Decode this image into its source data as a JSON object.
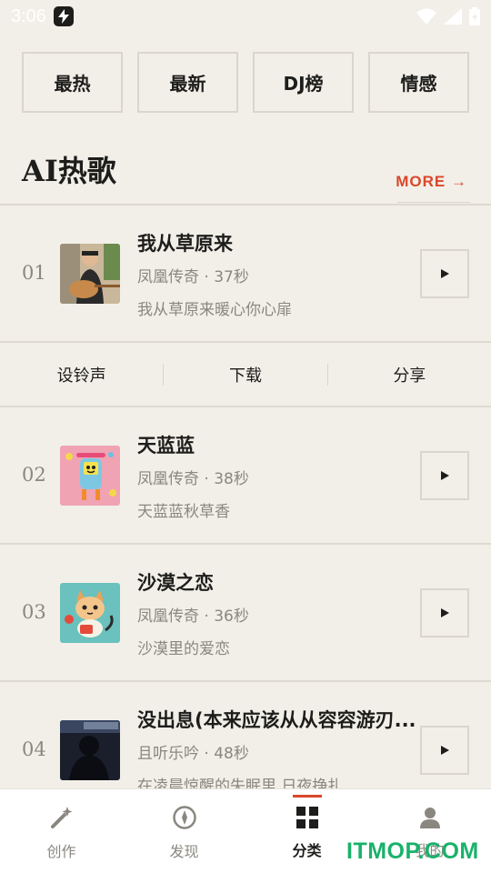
{
  "status_bar": {
    "time": "3:06"
  },
  "categories": [
    {
      "label": "最热"
    },
    {
      "label": "最新"
    },
    {
      "label": "DJ榜"
    },
    {
      "label": "情感"
    }
  ],
  "section": {
    "title": "AI热歌",
    "more_label": "MORE →"
  },
  "songs": [
    {
      "num": "01",
      "title": "我从草原来",
      "meta": "凤凰传奇 · 37秒",
      "lyric": "我从草原来暖心你心扉",
      "cover": "guitarist-photo"
    },
    {
      "num": "02",
      "title": "天蓝蓝",
      "meta": "凤凰传奇 · 38秒",
      "lyric": "天蓝蓝秋草香",
      "cover": "cartoon-character"
    },
    {
      "num": "03",
      "title": "沙漠之恋",
      "meta": "凤凰传奇 · 36秒",
      "lyric": "沙漠里的爱恋",
      "cover": "cartoon-cat"
    },
    {
      "num": "04",
      "title": "没出息(本来应该从从容容游刃...",
      "meta": "且听乐吟 · 48秒",
      "lyric": "在凌晨惊醒的失眠里 日夜挣扎",
      "cover": "dark-silhouette"
    }
  ],
  "song_actions": [
    {
      "label": "设铃声"
    },
    {
      "label": "下载"
    },
    {
      "label": "分享"
    }
  ],
  "bottom_nav": [
    {
      "label": "创作",
      "icon": "magic-wand-icon",
      "active": false
    },
    {
      "label": "发现",
      "icon": "compass-icon",
      "active": false
    },
    {
      "label": "分类",
      "icon": "grid-icon",
      "active": true
    },
    {
      "label": "我的",
      "icon": "user-icon",
      "active": false
    }
  ],
  "watermark": "ITMOP.COM",
  "colors": {
    "accent": "#d9472b",
    "background": "#f2efe8",
    "watermark": "#19b26b"
  }
}
